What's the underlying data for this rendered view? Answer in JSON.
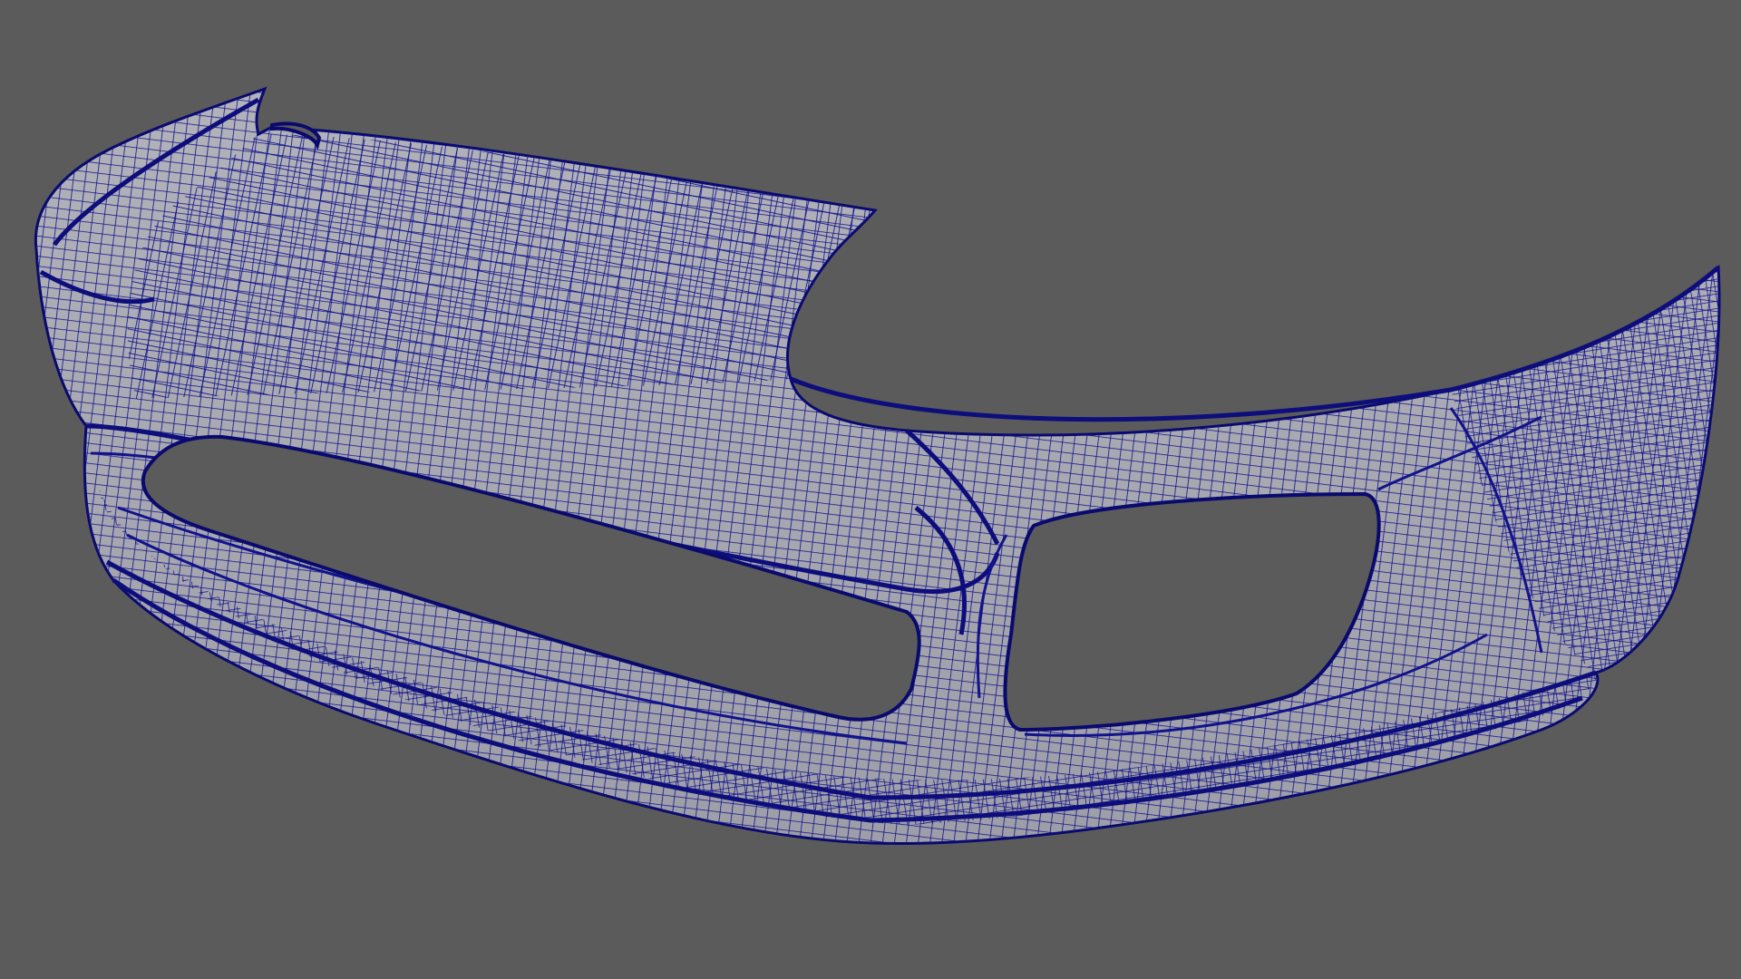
{
  "viewport": {
    "background_color": "#5b5b5b",
    "render_mode": "wireframe-on-shaded",
    "wire_color": "#0f0f85",
    "surface_color": "#a9a9b1",
    "surface_shadow_color": "#8c8c98"
  },
  "model": {
    "object": "front-bumper"
  }
}
